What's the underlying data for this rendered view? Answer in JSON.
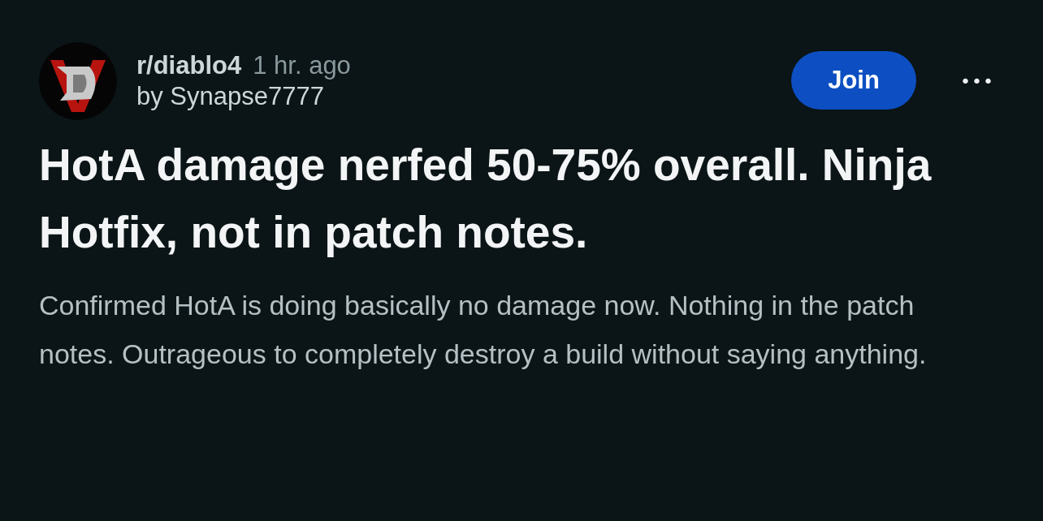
{
  "post": {
    "subreddit": "r/diablo4",
    "time": "1 hr. ago",
    "author": "by Synapse7777",
    "join_button": "Join",
    "more_button": "•••",
    "title": "HotA damage nerfed 50-75% overall. Ninja Hotfix, not in patch notes.",
    "body": "Confirmed HotA is doing basically no damage now. Nothing in the patch notes. Outrageous to completely destroy a build without saying anything."
  }
}
